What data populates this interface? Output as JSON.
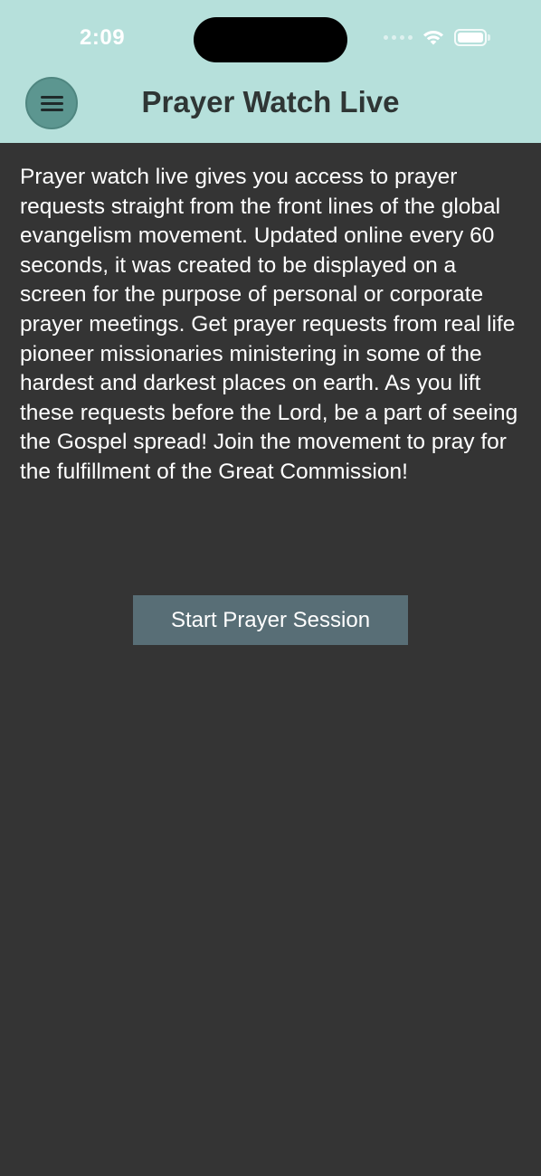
{
  "status_bar": {
    "time": "2:09"
  },
  "header": {
    "title": "Prayer Watch Live",
    "menu_icon": "hamburger-menu-icon"
  },
  "main": {
    "description": "Prayer watch live gives you access to prayer requests straight from the front lines of the global evangelism movement. Updated online every 60 seconds, it was created to be displayed on a screen for the purpose of personal or corporate prayer meetings. Get prayer requests from real life pioneer missionaries ministering in some of the hardest and darkest places on earth. As you lift these requests before the Lord, be a part of seeing the Gospel spread! Join the movement to pray for the fulfillment of the Great Commission!",
    "start_button_label": "Start Prayer Session"
  },
  "colors": {
    "header_bg": "#b6e0db",
    "page_bg": "#343434",
    "menu_button_bg": "#5c9690",
    "start_button_bg": "#586e76",
    "title_text": "#2f3635"
  }
}
